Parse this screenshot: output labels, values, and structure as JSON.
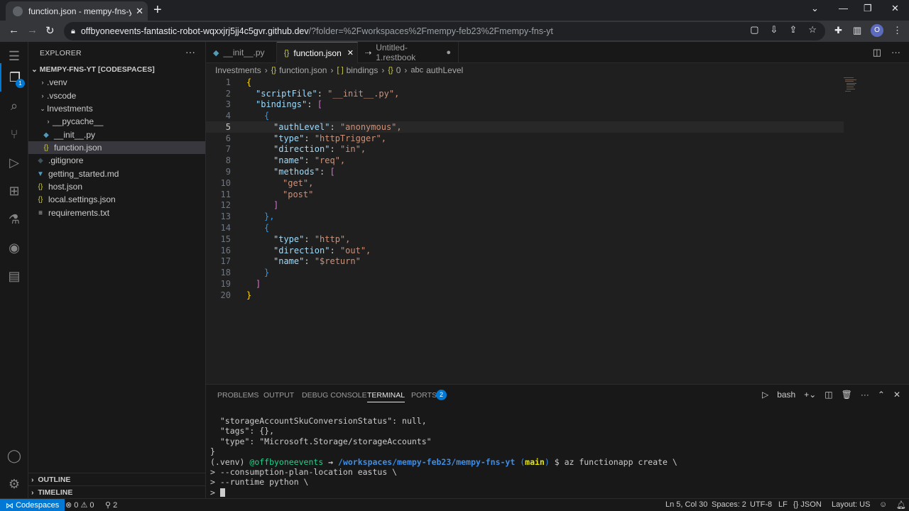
{
  "browser": {
    "tab_title": "function.json - mempy-fns-yt [Co",
    "url_host": "offbyoneevents-fantastic-robot-wqxxjrj5jj4c5gvr.github.dev",
    "url_path": "/?folder=%2Fworkspaces%2Fmempy-feb23%2Fmempy-fns-yt",
    "profile_initial": "O"
  },
  "activity": {
    "explorer_badge": "1"
  },
  "sidebar": {
    "title": "EXPLORER",
    "root": "MEMPY-FNS-YT [CODESPACES]",
    "items": [
      {
        "label": ".venv",
        "icon": "chevron-right"
      },
      {
        "label": ".vscode",
        "icon": "chevron-right"
      },
      {
        "label": "Investments",
        "icon": "chevron-down"
      },
      {
        "label": "__pycache__",
        "icon": "chevron-right"
      },
      {
        "label": "__init__.py",
        "icon": "python-icon"
      },
      {
        "label": "function.json",
        "icon": "json-icon"
      },
      {
        "label": ".gitignore",
        "icon": "git-icon"
      },
      {
        "label": "getting_started.md",
        "icon": "markdown-icon"
      },
      {
        "label": "host.json",
        "icon": "json-icon"
      },
      {
        "label": "local.settings.json",
        "icon": "json-icon"
      },
      {
        "label": "requirements.txt",
        "icon": "text-file-icon"
      }
    ],
    "outline": "OUTLINE",
    "timeline": "TIMELINE"
  },
  "tabs": [
    {
      "label": "__init__.py"
    },
    {
      "label": "function.json"
    },
    {
      "label": "Untitled-1.restbook"
    }
  ],
  "breadcrumb": {
    "b1": "Investments",
    "b2": "function.json",
    "b3": "bindings",
    "b4": "0",
    "b5": "authLevel"
  },
  "code": {
    "lines": [
      {
        "n": "1",
        "t": "{"
      },
      {
        "n": "2",
        "k": "\"scriptFile\"",
        "s": "\"__init__.py\","
      },
      {
        "n": "3",
        "k": "\"bindings\"",
        "s": "["
      },
      {
        "n": "4",
        "t": "{"
      },
      {
        "n": "5",
        "k": "\"authLevel\"",
        "s": "\"anonymous\","
      },
      {
        "n": "6",
        "k": "\"type\"",
        "s": "\"httpTrigger\","
      },
      {
        "n": "7",
        "k": "\"direction\"",
        "s": "\"in\","
      },
      {
        "n": "8",
        "k": "\"name\"",
        "s": "\"req\","
      },
      {
        "n": "9",
        "k": "\"methods\"",
        "s": "["
      },
      {
        "n": "10",
        "t": "\"get\","
      },
      {
        "n": "11",
        "t": "\"post\""
      },
      {
        "n": "12",
        "t": "]"
      },
      {
        "n": "13",
        "t": "},"
      },
      {
        "n": "14",
        "t": "{"
      },
      {
        "n": "15",
        "k": "\"type\"",
        "s": "\"http\","
      },
      {
        "n": "16",
        "k": "\"direction\"",
        "s": "\"out\","
      },
      {
        "n": "17",
        "k": "\"name\"",
        "s": "\"$return\""
      },
      {
        "n": "18",
        "t": "}"
      },
      {
        "n": "19",
        "t": "]"
      },
      {
        "n": "20",
        "t": "}"
      }
    ]
  },
  "panel": {
    "tabs": [
      "PROBLEMS",
      "OUTPUT",
      "DEBUG CONSOLE",
      "TERMINAL",
      "PORTS"
    ],
    "ports_badge": "2",
    "shell": "bash",
    "terminal_lines": [
      "  \"storageAccountSkuConversionStatus\": null,",
      "  \"tags\": {},",
      "  \"type\": \"Microsoft.Storage/storageAccounts\"",
      "}"
    ],
    "prompt": {
      "venv": "(.venv) ",
      "user": "@offbyoneevents ",
      "arrow": "→",
      "path": " /workspaces/mempy-feb23/mempy-fns-yt ",
      "branch_open": "(",
      "branch": "main",
      "branch_close": ")",
      "cmd": " $ az functionapp create \\"
    },
    "continuation": [
      "> --consumption-plan-location eastus \\",
      "> --runtime python \\",
      "> "
    ]
  },
  "status": {
    "remote": "Codespaces",
    "errors": "0",
    "warnings": "0",
    "ports": "2",
    "position": "Ln 5, Col 30",
    "spaces": "Spaces: 2",
    "encoding": "UTF-8",
    "eol": "LF",
    "language": "JSON",
    "layout": "Layout: US"
  }
}
